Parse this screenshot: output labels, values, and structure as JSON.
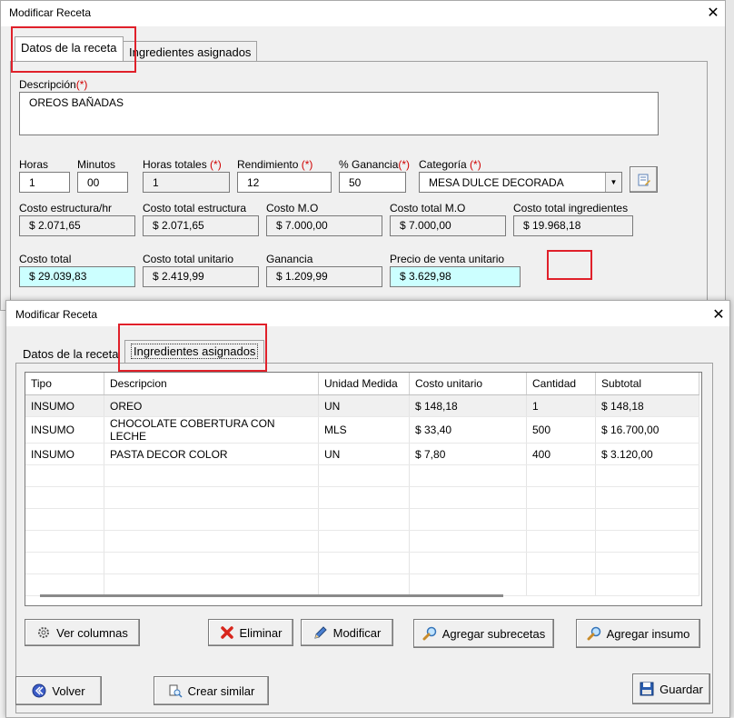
{
  "back_window": {
    "title": "Modificar Receta",
    "tabs": [
      {
        "label": "Datos de la receta"
      },
      {
        "label": "Ingredientes asignados"
      }
    ],
    "descripcion": {
      "label": "Descripción",
      "required_mark": "(*)",
      "value": "OREOS BAÑADAS"
    },
    "horas": {
      "label": "Horas",
      "value": "1"
    },
    "minutos": {
      "label": "Minutos",
      "value": "00"
    },
    "horas_totales": {
      "label": "Horas totales",
      "required_mark": "(*)",
      "value": "1"
    },
    "rendimiento": {
      "label": "Rendimiento",
      "required_mark": "(*)",
      "value": "12"
    },
    "ganancia_pct": {
      "label": "% Ganancia",
      "required_mark": "(*)",
      "value": "50"
    },
    "categoria": {
      "label": "Categoría",
      "required_mark": "(*)",
      "value": "MESA DULCE DECORADA"
    },
    "costo_estructura_hr": {
      "label": "Costo estructura/hr",
      "value": "$ 2.071,65"
    },
    "costo_total_estructura": {
      "label": "Costo total estructura",
      "value": "$ 2.071,65"
    },
    "costo_mo": {
      "label": "Costo M.O",
      "value": "$ 7.000,00"
    },
    "costo_total_mo": {
      "label": "Costo total M.O",
      "value": "$ 7.000,00"
    },
    "costo_total_ingredientes": {
      "label": "Costo total ingredientes",
      "value": "$ 19.968,18"
    },
    "costo_total": {
      "label": "Costo total",
      "value": "$ 29.039,83"
    },
    "costo_total_unitario": {
      "label": "Costo total unitario",
      "value": "$ 2.419,99"
    },
    "ganancia": {
      "label": "Ganancia",
      "value": "$ 1.209,99"
    },
    "precio_venta_unitario": {
      "label": "Precio de venta unitario",
      "value": "$ 3.629,98"
    }
  },
  "front_window": {
    "title": "Modificar Receta",
    "tabs": [
      {
        "label": "Datos de la receta"
      },
      {
        "label": "Ingredientes asignados"
      }
    ],
    "table": {
      "columns": [
        "Tipo",
        "Descripcion",
        "Unidad Medida",
        "Costo unitario",
        "Cantidad",
        "Subtotal"
      ],
      "rows": [
        [
          "INSUMO",
          "OREO",
          "UN",
          "$ 148,18",
          "1",
          "$ 148,18"
        ],
        [
          "INSUMO",
          "CHOCOLATE COBERTURA CON LECHE",
          "MLS",
          "$ 33,40",
          "500",
          "$ 16.700,00"
        ],
        [
          "INSUMO",
          "PASTA DECOR COLOR",
          "UN",
          "$ 7,80",
          "400",
          "$ 3.120,00"
        ]
      ]
    },
    "buttons": {
      "ver_columnas": "Ver columnas",
      "eliminar": "Eliminar",
      "modificar": "Modificar",
      "agregar_subrecetas": "Agregar subrecetas",
      "agregar_insumo": "Agregar insumo",
      "volver": "Volver",
      "crear_similar": "Crear similar",
      "guardar": "Guardar"
    }
  },
  "colors": {
    "highlight_red": "#e0202a",
    "cyan_field": "#ccffff",
    "required": "#d00000"
  }
}
